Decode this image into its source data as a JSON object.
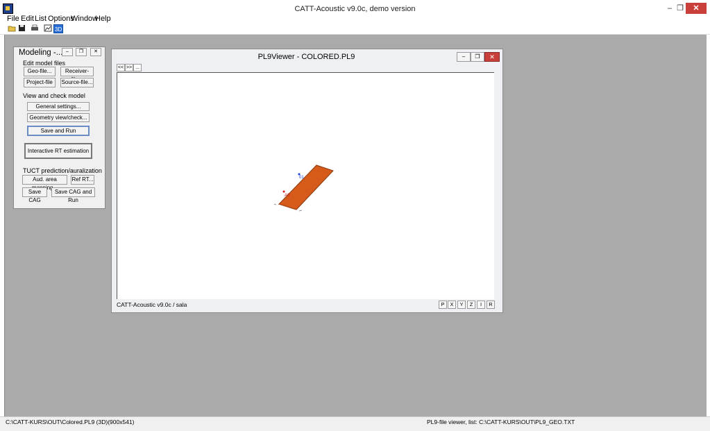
{
  "app": {
    "title": "CATT-Acoustic v9.0c, demo version"
  },
  "window_controls": {
    "minimize": "–",
    "restore": "❐",
    "close": "✕"
  },
  "menu": [
    "File",
    "Edit",
    "List",
    "Options",
    "Window",
    "Help"
  ],
  "toolbar": {
    "icons": [
      "open-folder-icon",
      "save-icon",
      "print-icon",
      "image-icon",
      "3d-view-icon"
    ]
  },
  "modeling": {
    "title": "Modeling -...",
    "edit_group": "Edit model files",
    "geo": "Geo-file...",
    "receiver": "Receiver-file...",
    "project": "Project-file",
    "source": "Source-file...",
    "view_group": "View and check model",
    "general": "General settings...",
    "geometry": "Geometry view/check...",
    "save_run": "Save and Run",
    "rt": "Interactive RT estimation",
    "tuct_group": "TUCT prediction/auralization",
    "aud": "Aud. area mapping...",
    "ref": "Ref RT...",
    "save_cag": "Save CAG",
    "save_cag_run": "Save CAG and Run"
  },
  "viewer": {
    "title": "PL9Viewer - COLORED.PL9",
    "nav": [
      "<<",
      ">>",
      "..."
    ],
    "status": "CATT-Acoustic v9.0c / sala",
    "axis_buttons": [
      "P",
      "X",
      "Y",
      "Z",
      "I",
      "R"
    ],
    "labels": {
      "receiver": "01",
      "source": "A0"
    },
    "plane_color": "#d65a1a"
  },
  "statusbar": {
    "left": "C:\\CATT-KURS\\OUT\\Colored.PL9 (3D)(900x541)",
    "right": "PL9-file viewer, list: C:\\CATT-KURS\\OUT\\PL9_GEO.TXT"
  }
}
